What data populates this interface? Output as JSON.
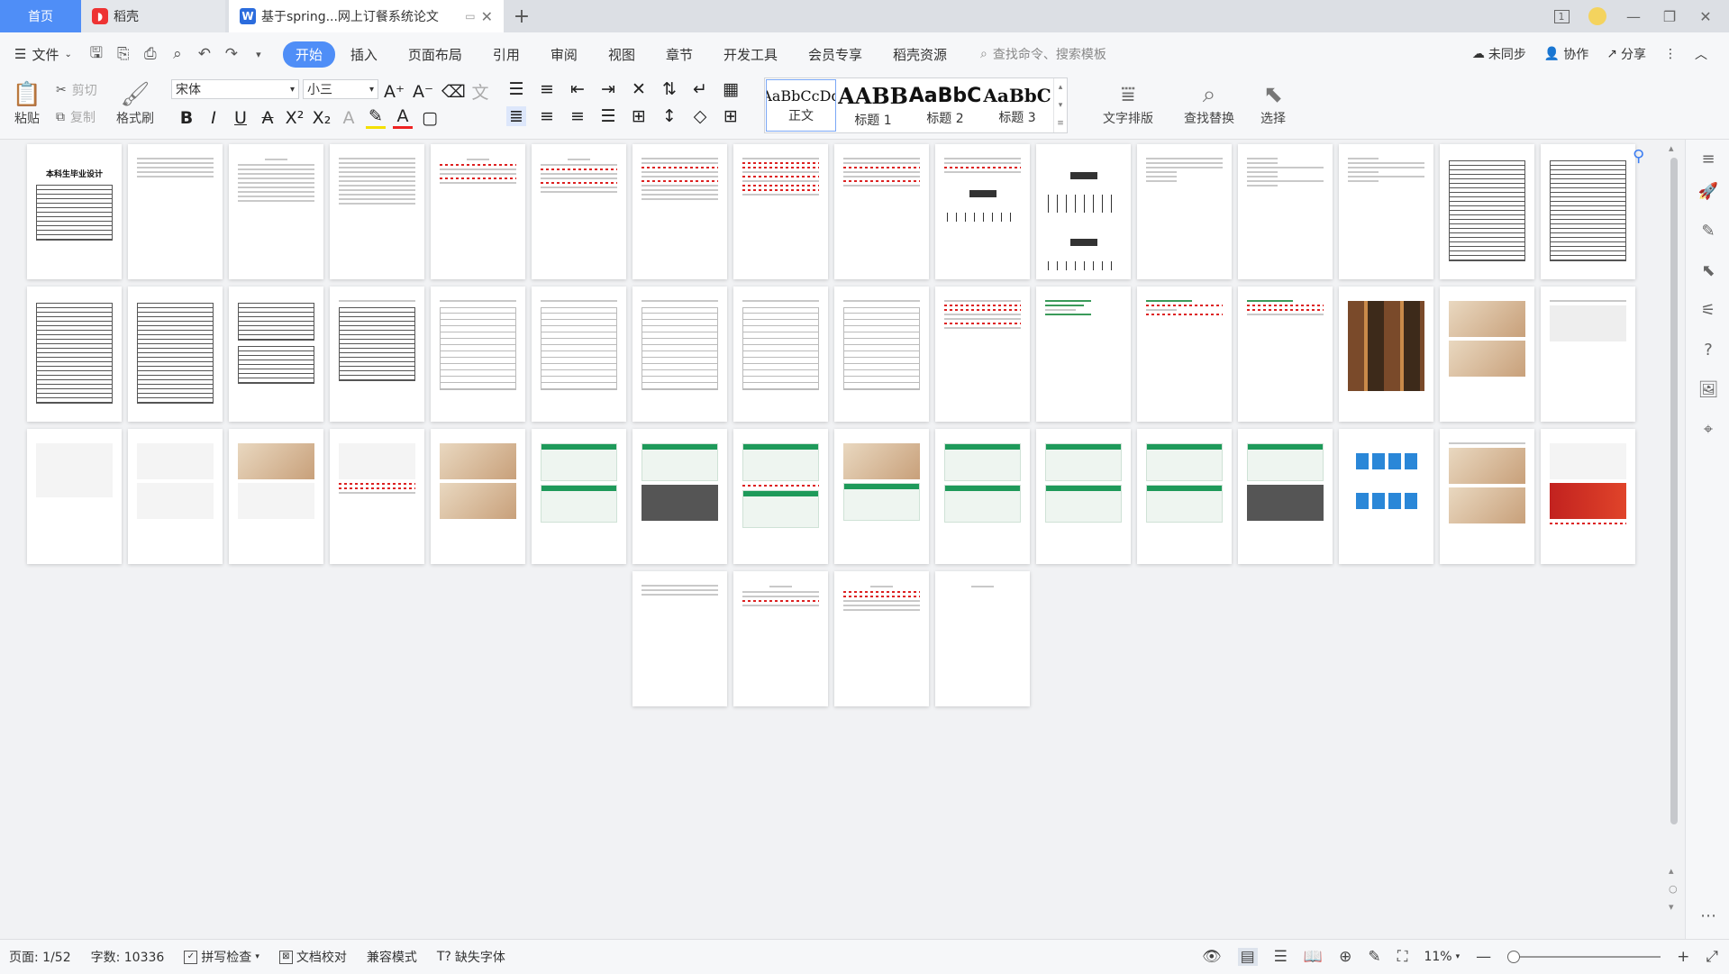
{
  "tabs": {
    "home": "首页",
    "daoke": "稻壳",
    "doc_title": "基于spring...网上订餐系统论文",
    "add": "+"
  },
  "window": {
    "page_count_badge": "1"
  },
  "menu": {
    "file": "文件",
    "items": [
      "开始",
      "插入",
      "页面布局",
      "引用",
      "审阅",
      "视图",
      "章节",
      "开发工具",
      "会员专享",
      "稻壳资源"
    ],
    "search_placeholder": "查找命令、搜索模板",
    "sync": "未同步",
    "collab": "协作",
    "share": "分享"
  },
  "ribbon": {
    "paste": "粘贴",
    "cut": "剪切",
    "copy": "复制",
    "format_painter": "格式刷",
    "font_name": "宋体",
    "font_size": "小三",
    "styles": [
      {
        "sample": "AaBbCcDd",
        "name": "正文"
      },
      {
        "sample": "AABB",
        "name": "标题 1"
      },
      {
        "sample": "AaBbC",
        "name": "标题 2"
      },
      {
        "sample": "AaBbC",
        "name": "标题 3"
      }
    ],
    "text_layout": "文字排版",
    "find_replace": "查找替换",
    "select": "选择"
  },
  "document": {
    "cover_title": "本科生毕业设计"
  },
  "status": {
    "page": "页面: 1/52",
    "words": "字数: 10336",
    "spell": "拼写检查",
    "doc_check": "文档校对",
    "compat": "兼容模式",
    "missing_font": "缺失字体",
    "zoom": "11%"
  }
}
